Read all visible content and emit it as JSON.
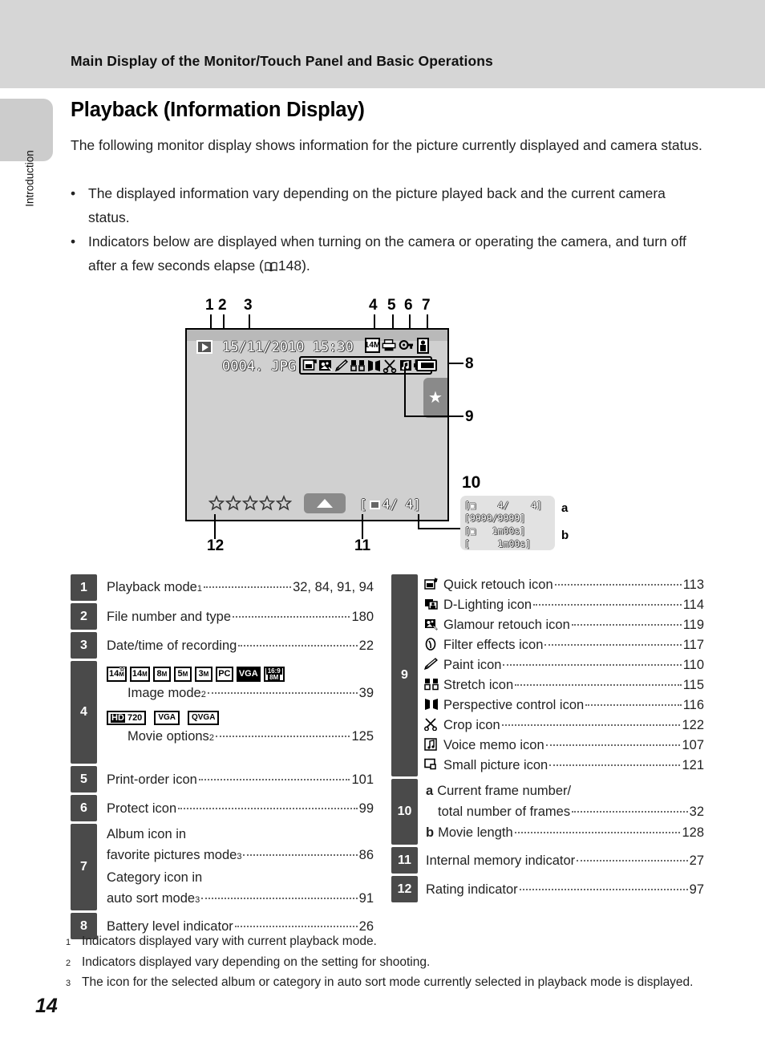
{
  "header": {
    "title": "Main Display of the Monitor/Touch Panel and Basic Operations"
  },
  "side_tab": {
    "label": "Introduction"
  },
  "page": {
    "number": "14"
  },
  "section": {
    "heading": "Playback (Information Display)",
    "intro": "The following monitor display shows information for the picture currently displayed and camera status.",
    "bullets": [
      "The displayed information vary depending on the picture played back and the current camera status.",
      "Indicators below are displayed when turning on the camera or operating the camera, and turn off after a few seconds elapse ("
    ],
    "bullet2_page": "148).",
    "bullet_dot": "•"
  },
  "figure": {
    "callout_labels": {
      "n1": "1",
      "n2": "2",
      "n3": "3",
      "n4": "4",
      "n5": "5",
      "n6": "6",
      "n7": "7",
      "n8": "8",
      "n9": "9",
      "n10": "10",
      "n11": "11",
      "n12": "12",
      "a": "a",
      "b": "b"
    },
    "monitor": {
      "playback_mode_icon": "play-icon",
      "datetime": "15/11/2010  15:30",
      "filename": "0004. JPG",
      "image_mode_badge": "14M",
      "frame_counter": "4/     4]",
      "counter_prefix": "[",
      "rating_stars": 5,
      "star_tab_glyph": "★"
    },
    "detail_callout": {
      "line1": "[▣    4/    4]",
      "line2": "[9999/9999]",
      "line3": "[▣   1m00s]",
      "line4": "[     1m00s]"
    }
  },
  "legend_left": [
    {
      "num": "1",
      "entries": [
        {
          "text": "Playback mode",
          "sup": "1",
          "page": "32, 84, 91, 94"
        }
      ]
    },
    {
      "num": "2",
      "entries": [
        {
          "text": "File number and type",
          "sup": "",
          "page": "180"
        }
      ]
    },
    {
      "num": "3",
      "entries": [
        {
          "text": "Date/time of recording",
          "sup": "",
          "page": "22"
        }
      ]
    },
    {
      "num": "4",
      "image_mode_icons": [
        "14M★",
        "14M",
        "8M",
        "5M",
        "3M",
        "PC",
        "VGA",
        "16:9 8M"
      ],
      "movie_option_icons": [
        "HD 720",
        "VGA",
        "QVGA"
      ],
      "entries": [
        {
          "text": "Image mode",
          "sup": "2",
          "page": "39"
        },
        {
          "text": "Movie options",
          "sup": "2",
          "page": "125"
        }
      ]
    },
    {
      "num": "5",
      "entries": [
        {
          "text": "Print-order icon",
          "sup": "",
          "page": "101"
        }
      ]
    },
    {
      "num": "6",
      "entries": [
        {
          "text": "Protect icon",
          "sup": "",
          "page": "99"
        }
      ]
    },
    {
      "num": "7",
      "entries": [
        {
          "text": "Album icon in",
          "sup": "",
          "page": ""
        },
        {
          "text": "favorite pictures mode",
          "sup": "3",
          "page": "86"
        },
        {
          "text": "Category icon in",
          "sup": "",
          "page": ""
        },
        {
          "text": "auto sort mode",
          "sup": "3",
          "page": "91"
        }
      ]
    },
    {
      "num": "8",
      "entries": [
        {
          "text": "Battery level indicator",
          "sup": "",
          "page": "26"
        }
      ]
    }
  ],
  "legend_right": [
    {
      "num": "9",
      "entries": [
        {
          "icon": "quick-retouch-icon",
          "text": "Quick retouch icon",
          "page": "113"
        },
        {
          "icon": "d-lighting-icon",
          "text": "D-Lighting icon",
          "page": "114"
        },
        {
          "icon": "glamour-retouch-icon",
          "text": "Glamour retouch icon",
          "page": "119"
        },
        {
          "icon": "filter-effects-icon",
          "text": "Filter effects icon",
          "page": "117"
        },
        {
          "icon": "paint-icon",
          "text": "Paint icon",
          "page": "110"
        },
        {
          "icon": "stretch-icon",
          "text": "Stretch icon",
          "page": "115"
        },
        {
          "icon": "perspective-control-icon",
          "text": "Perspective control icon",
          "page": "116"
        },
        {
          "icon": "crop-icon",
          "text": "Crop icon",
          "page": "122"
        },
        {
          "icon": "voice-memo-icon",
          "text": "Voice memo icon",
          "page": "107"
        },
        {
          "icon": "small-picture-icon",
          "text": "Small picture icon",
          "page": "121"
        }
      ]
    },
    {
      "num": "10",
      "entries": [
        {
          "bold": "a",
          "text": "Current frame number/",
          "page": ""
        },
        {
          "bold": "",
          "text": "total number of frames",
          "page": "32"
        },
        {
          "bold": "b",
          "text": "Movie length",
          "page": "128"
        }
      ]
    },
    {
      "num": "11",
      "entries": [
        {
          "bold": "",
          "text": "Internal memory indicator",
          "page": "27"
        }
      ]
    },
    {
      "num": "12",
      "entries": [
        {
          "bold": "",
          "text": "Rating indicator",
          "page": "97"
        }
      ]
    }
  ],
  "footnotes": [
    {
      "mark": "1",
      "text": "Indicators displayed vary with current playback mode."
    },
    {
      "mark": "2",
      "text": "Indicators displayed vary depending on the setting for shooting."
    },
    {
      "mark": "3",
      "text": "The icon for the selected album or category in auto sort mode currently selected in playback mode is displayed."
    }
  ]
}
